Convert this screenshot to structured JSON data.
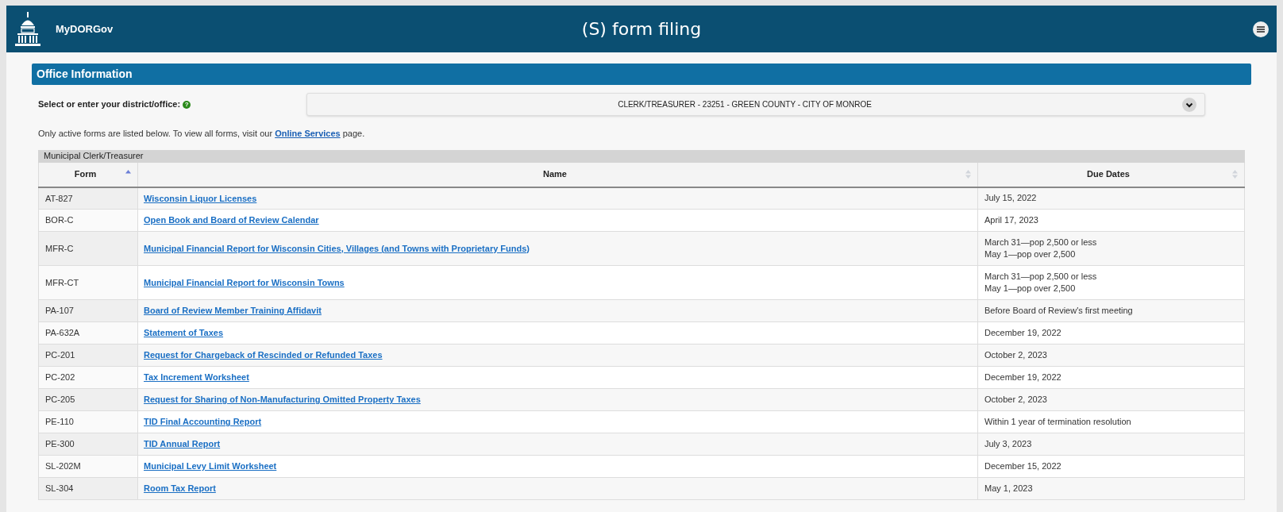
{
  "header": {
    "brand": "MyDORGov",
    "title": "(S) form filing"
  },
  "section": {
    "title": "Office Information"
  },
  "office_select": {
    "label": "Select or enter your district/office:",
    "help_icon": "?",
    "value": "CLERK/TREASURER - 23251 - GREEN COUNTY - CITY OF MONROE"
  },
  "notice": {
    "before": "Only active forms are listed below. To view all forms, visit our ",
    "link": "Online Services",
    "after": " page."
  },
  "table": {
    "caption": "Municipal Clerk/Treasurer",
    "columns": [
      {
        "label": "Form",
        "sorted": true
      },
      {
        "label": "Name",
        "sorted": false
      },
      {
        "label": "Due Dates",
        "sorted": false
      }
    ],
    "rows": [
      {
        "form": "AT-827",
        "name": "Wisconsin Liquor Licenses",
        "due": [
          "July 15, 2022"
        ]
      },
      {
        "form": "BOR-C",
        "name": "Open Book and Board of Review Calendar",
        "due": [
          "April 17, 2023"
        ]
      },
      {
        "form": "MFR-C",
        "name": "Municipal Financial Report for Wisconsin Cities, Villages (and Towns with Proprietary Funds)",
        "due": [
          "March 31—pop 2,500 or less",
          "May 1—pop over 2,500"
        ]
      },
      {
        "form": "MFR-CT",
        "name": "Municipal Financial Report for Wisconsin Towns",
        "due": [
          "March 31—pop 2,500 or less",
          "May 1—pop over 2,500"
        ]
      },
      {
        "form": "PA-107",
        "name": "Board of Review Member Training Affidavit",
        "due": [
          "Before Board of Review's first meeting"
        ]
      },
      {
        "form": "PA-632A",
        "name": "Statement of Taxes",
        "due": [
          "December 19, 2022"
        ]
      },
      {
        "form": "PC-201",
        "name": "Request for Chargeback of Rescinded or Refunded Taxes",
        "due": [
          "October 2, 2023"
        ]
      },
      {
        "form": "PC-202",
        "name": "Tax Increment Worksheet",
        "due": [
          "December 19, 2022"
        ]
      },
      {
        "form": "PC-205",
        "name": "Request for Sharing of Non-Manufacturing Omitted Property Taxes",
        "due": [
          "October 2, 2023"
        ]
      },
      {
        "form": "PE-110",
        "name": "TID Final Accounting Report",
        "due": [
          "Within 1 year of termination resolution"
        ]
      },
      {
        "form": "PE-300",
        "name": "TID Annual Report",
        "due": [
          "July 3, 2023"
        ]
      },
      {
        "form": "SL-202M",
        "name": "Municipal Levy Limit Worksheet",
        "due": [
          "December 15, 2022"
        ]
      },
      {
        "form": "SL-304",
        "name": "Room Tax Report",
        "due": [
          "May 1, 2023"
        ]
      }
    ]
  }
}
